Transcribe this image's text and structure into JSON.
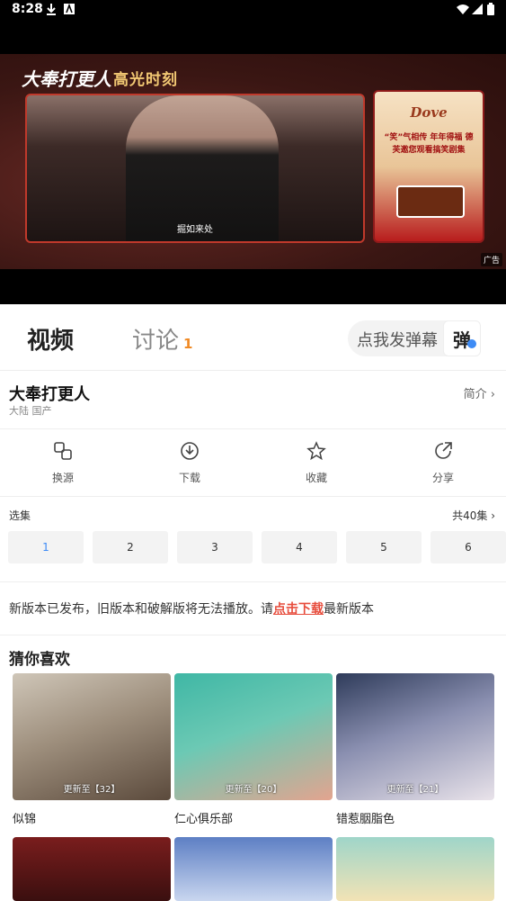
{
  "status": {
    "time": "8:28"
  },
  "video": {
    "brand": "大奉打更人",
    "highlight": "高光时刻",
    "caption": "掘如来处",
    "ad": {
      "logo": "Dove",
      "text": "“笑”气相传 年年得福 德芙邀您观看搞笑剧集",
      "badge": "广告"
    }
  },
  "tabs": {
    "video": "视频",
    "discuss": "讨论",
    "discuss_count": "1",
    "danmu_placeholder": "点我发弹幕",
    "danmu_button": "弹"
  },
  "show": {
    "title": "大奉打更人",
    "meta": "大陆 国产",
    "intro": "简介 ›"
  },
  "actions": [
    {
      "label": "换源",
      "icon": "switch-source-icon"
    },
    {
      "label": "下载",
      "icon": "download-icon"
    },
    {
      "label": "收藏",
      "icon": "star-icon"
    },
    {
      "label": "分享",
      "icon": "share-icon"
    }
  ],
  "episodes": {
    "header": "选集",
    "total": "共40集 ›",
    "items": [
      "1",
      "2",
      "3",
      "4",
      "5",
      "6"
    ],
    "active": "1"
  },
  "notice": {
    "before": "新版本已发布，旧版本和破解版将无法播放。请",
    "link": "点击下载",
    "after": "最新版本"
  },
  "recommend": {
    "header": "猜你喜欢",
    "items": [
      {
        "title": "似锦",
        "update": "更新至【32】"
      },
      {
        "title": "仁心俱乐部",
        "update": "更新至【20】"
      },
      {
        "title": "错惹胭脂色",
        "update": "更新至【21】"
      }
    ]
  },
  "colors": {
    "accent": "#3d8bf5",
    "badge": "#f08a24",
    "link": "#e74c3c"
  }
}
